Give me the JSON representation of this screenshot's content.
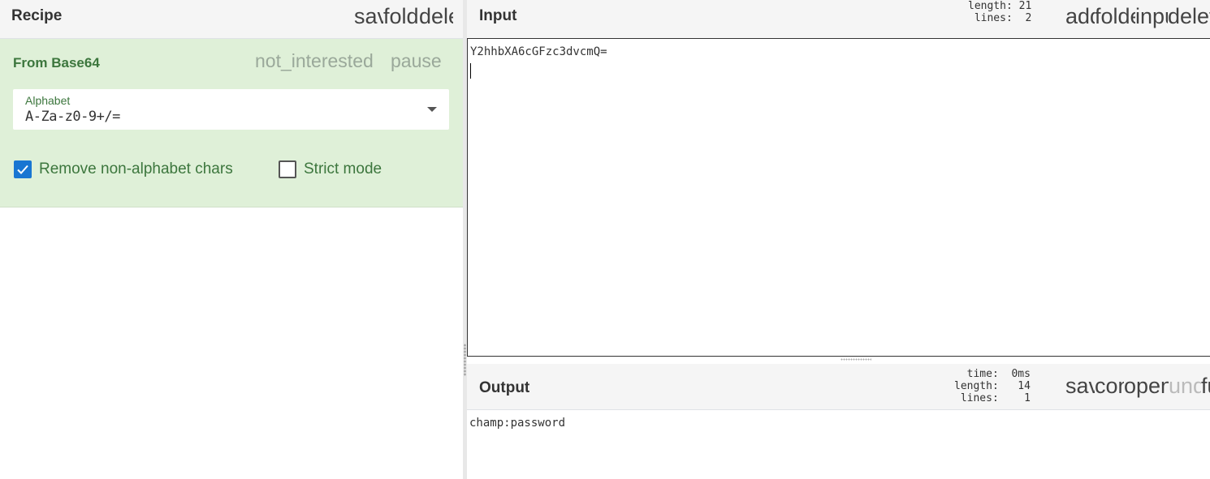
{
  "recipe": {
    "title": "Recipe",
    "icons": [
      {
        "name": "save-icon",
        "text": "save"
      },
      {
        "name": "folder-icon",
        "text": "folder"
      },
      {
        "name": "delete-icon",
        "text": "delete"
      }
    ],
    "operation": {
      "title": "From Base64",
      "disable_icon": "not_interested",
      "pause_icon": "pause",
      "alphabet_label": "Alphabet",
      "alphabet_value": "A-Za-z0-9+/=",
      "remove_non_alphabet_label": "Remove non-alphabet chars",
      "remove_non_alphabet_checked": true,
      "strict_mode_label": "Strict mode",
      "strict_mode_checked": false
    }
  },
  "input": {
    "title": "Input",
    "stats": "length: 21\n lines:  2",
    "icons": [
      {
        "name": "add-icon",
        "text": "add"
      },
      {
        "name": "folder-icon",
        "text": "folder"
      },
      {
        "name": "input-icon",
        "text": "input"
      },
      {
        "name": "delete-icon",
        "text": "delete"
      }
    ],
    "text": "Y2hhbXA6cGFzc3dvcmQ="
  },
  "output": {
    "title": "Output",
    "stats": "  time:  0ms\nlength:   14\n lines:    1",
    "icons": [
      {
        "name": "save-icon",
        "text": "save"
      },
      {
        "name": "copy-icon",
        "text": "content_copy"
      },
      {
        "name": "open-in-icon",
        "text": "open_in_browser"
      },
      {
        "name": "undo-icon",
        "text": "undo"
      },
      {
        "name": "fullscreen-icon",
        "text": "fullscreen"
      }
    ],
    "text": "champ:password"
  },
  "colors": {
    "operation_bg": "#dff0d8",
    "operation_text": "#3c763d",
    "checkbox_checked": "#1976d2"
  }
}
